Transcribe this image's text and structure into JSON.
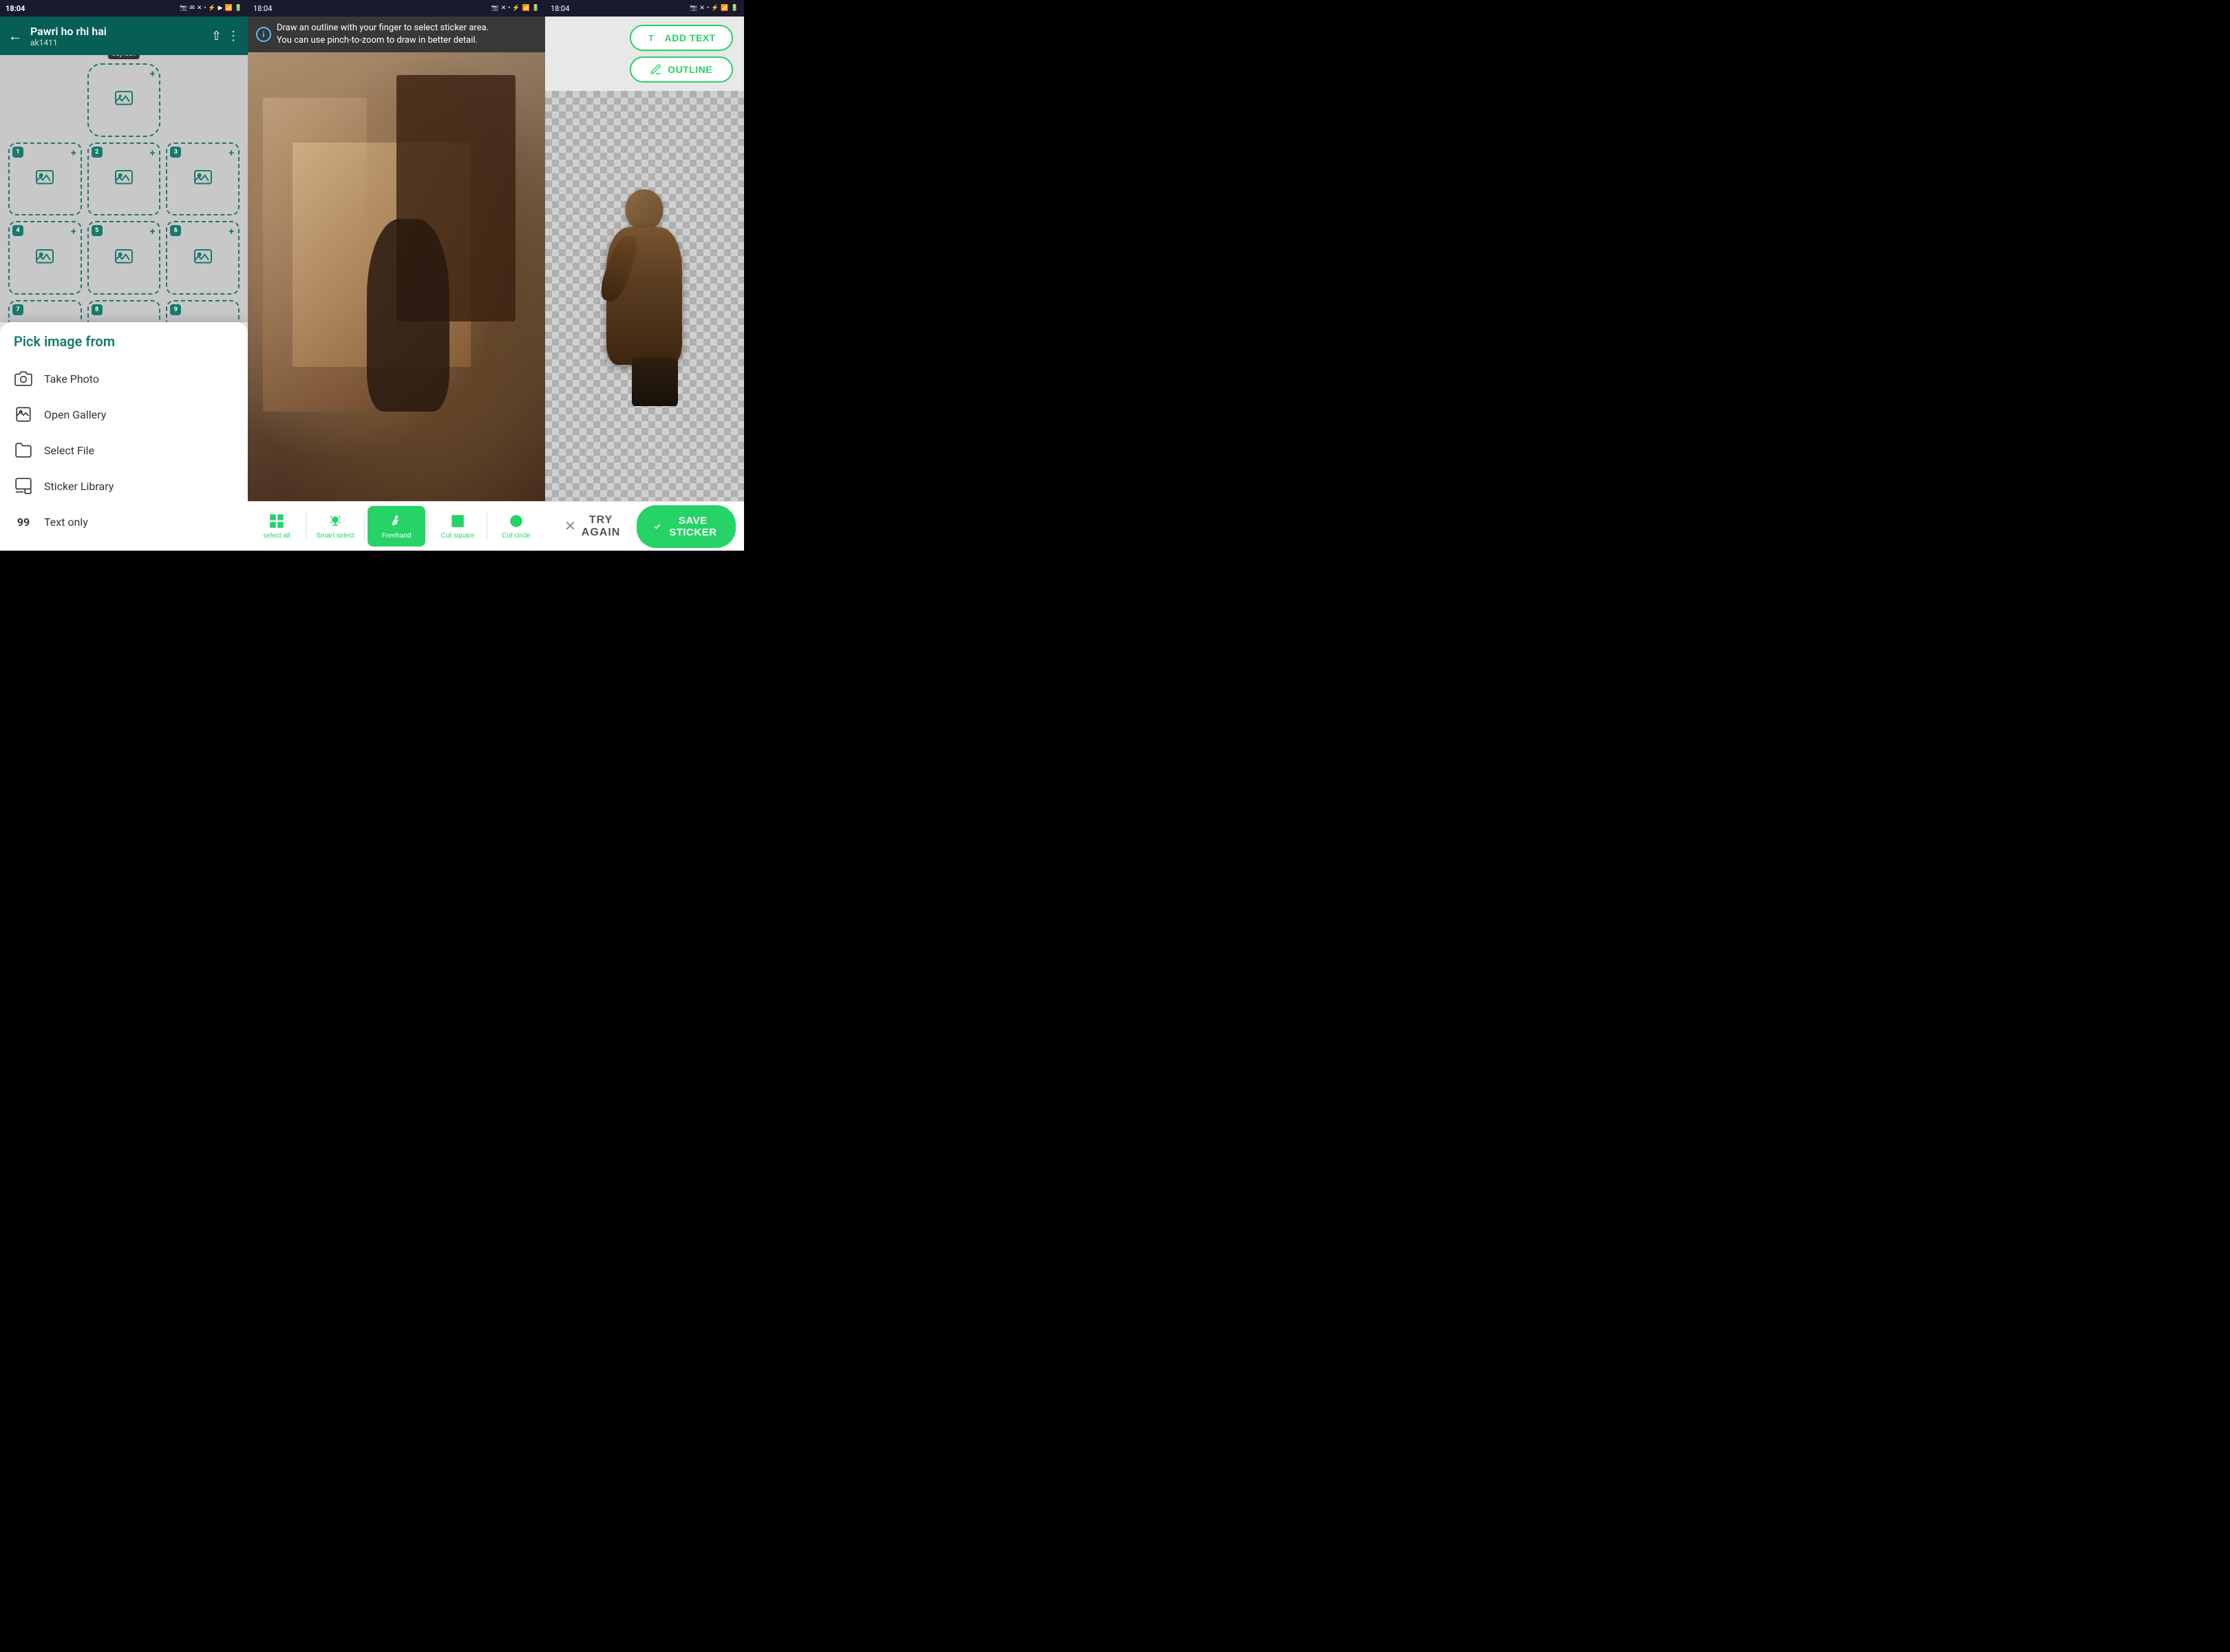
{
  "panel_left": {
    "status_bar": {
      "time": "18:04",
      "icons": "📷 ✉ ✕ •"
    },
    "header": {
      "title": "Pawri ho rhi hai",
      "subtitle": "ak1411",
      "back_label": "←",
      "share_label": "share",
      "menu_label": "⋮"
    },
    "sticker_cells": [
      {
        "number": null,
        "label": "tray icon",
        "is_tray": true
      },
      {
        "number": "1",
        "label": ""
      },
      {
        "number": "2",
        "label": ""
      },
      {
        "number": "3",
        "label": ""
      },
      {
        "number": "4",
        "label": ""
      },
      {
        "number": "5",
        "label": ""
      },
      {
        "number": "6",
        "label": ""
      },
      {
        "number": "7",
        "label": ""
      },
      {
        "number": "8",
        "label": ""
      },
      {
        "number": "9",
        "label": ""
      }
    ],
    "bottom_sheet": {
      "title": "Pick image from",
      "items": [
        {
          "icon": "camera",
          "label": "Take Photo"
        },
        {
          "icon": "gallery",
          "label": "Open Gallery"
        },
        {
          "icon": "file",
          "label": "Select File"
        },
        {
          "icon": "sticker",
          "label": "Sticker Library"
        },
        {
          "icon": "text",
          "label": "Text only"
        }
      ]
    }
  },
  "panel_mid": {
    "status_bar": {
      "time": "18:04",
      "icons": "📷 ✕ •"
    },
    "info_banner": {
      "text_line1": "Draw an outline with your finger to select sticker area.",
      "text_line2": "You can use pinch-to-zoom to draw in better detail."
    },
    "tools": [
      {
        "id": "select-all",
        "label": "select all",
        "active": false
      },
      {
        "id": "smart-select",
        "label": "Smart select",
        "active": false
      },
      {
        "id": "freehand",
        "label": "Freehand",
        "active": true
      },
      {
        "id": "cut-square",
        "label": "Cut square",
        "active": false
      },
      {
        "id": "cut-circle",
        "label": "Cut circle",
        "active": false
      }
    ]
  },
  "panel_right": {
    "status_bar": {
      "time": "18:04",
      "icons": "📷 ✕ •"
    },
    "action_buttons": [
      {
        "id": "add-text",
        "label": "ADD TEXT",
        "icon": "text"
      },
      {
        "id": "outline",
        "label": "OUTLINE",
        "icon": "pencil"
      }
    ],
    "bottom_actions": {
      "try_again": "TRY AGAIN",
      "save_sticker": "SAVE STICKER"
    }
  }
}
